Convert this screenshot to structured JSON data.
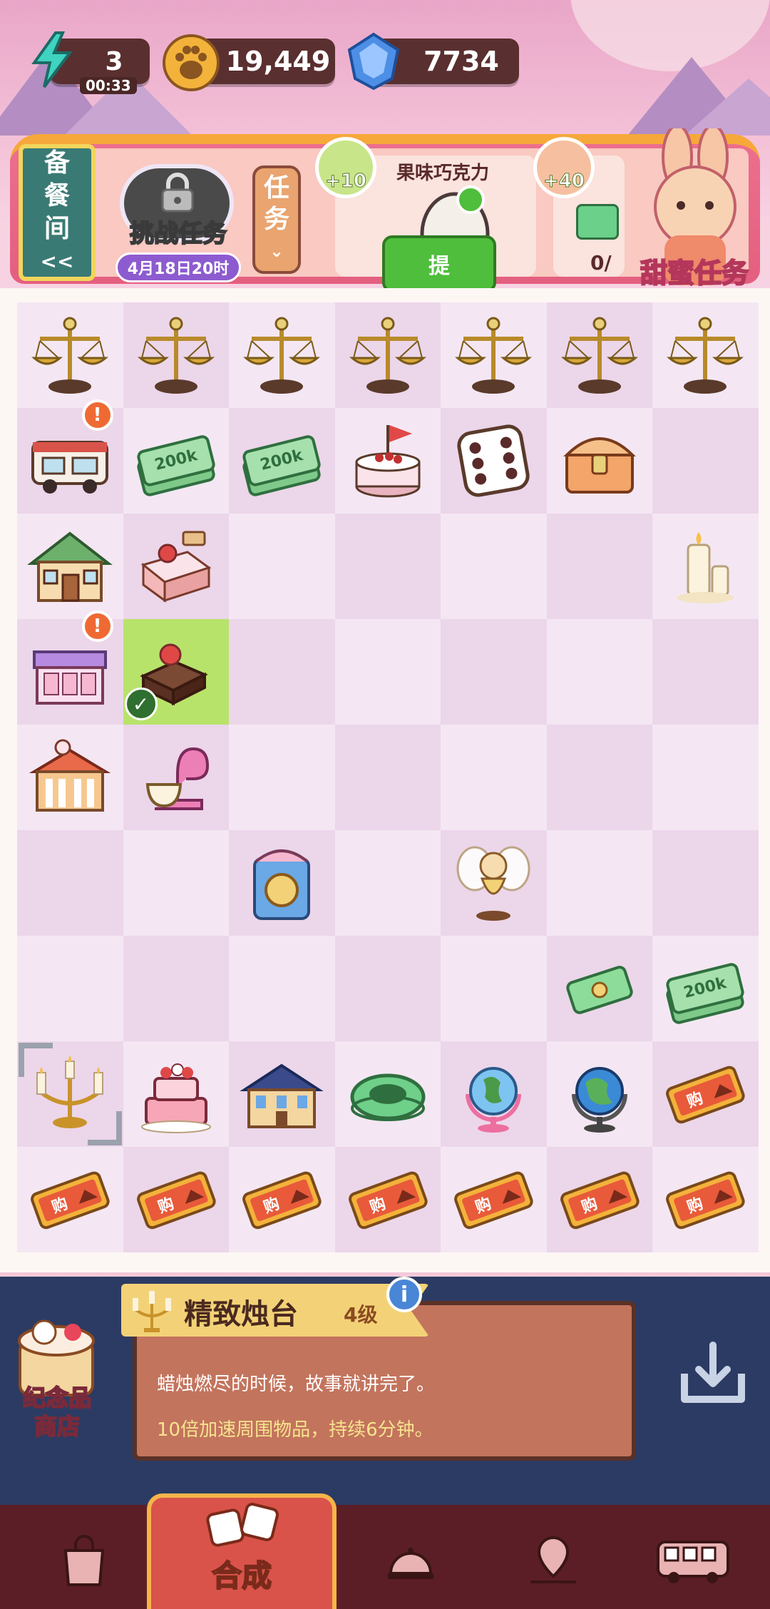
{
  "topbar": {
    "energy_value": "3",
    "energy_timer": "00:33",
    "coins_value": "19,449",
    "gems_value": "7734"
  },
  "banner": {
    "storage_label_line1": "备",
    "storage_label_line2": "餐",
    "storage_label_line3": "间",
    "storage_arrow": "<<",
    "challenge_label": "挑战任务",
    "challenge_date": "4月18日20时",
    "task_tab_line1": "任",
    "task_tab_line2": "务",
    "order1_reward": "+10",
    "order1_name": "果味巧克力",
    "order1_button": "提",
    "order2_reward": "+40",
    "order2_progress": "0/",
    "sweet_task_label": "甜蜜任务"
  },
  "board": {
    "rows": [
      [
        "scale",
        "scale",
        "scale",
        "scale",
        "scale",
        "scale",
        "scale"
      ],
      [
        "food-truck",
        "cash-200k",
        "cash-200k",
        "flag-cake",
        "dice",
        "chest",
        ""
      ],
      [
        "cottage",
        "strawberry-cake",
        "",
        "",
        "",
        "",
        "candle-melt"
      ],
      [
        "shop-stall",
        "chocolate",
        "",
        "",
        "",
        "",
        ""
      ],
      [
        "bakery",
        "mixer",
        "",
        "",
        "",
        "",
        ""
      ],
      [
        "",
        "",
        "trophy-frame",
        "",
        "fairy",
        "",
        ""
      ],
      [
        "",
        "",
        "",
        "",
        "",
        "ticket",
        "cash-200k"
      ],
      [
        "candelabra",
        "tiered-cake",
        "mansion",
        "film-ring",
        "globe-pink",
        "globe-blue",
        "coupon"
      ],
      [
        "coupon",
        "coupon",
        "coupon",
        "coupon",
        "coupon",
        "coupon",
        "coupon"
      ]
    ],
    "cash_label": "200k",
    "coupon_label": "购"
  },
  "info": {
    "item_name": "精致烛台",
    "item_level": "4级",
    "item_description": "蜡烛燃尽的时候，故事就讲完了。",
    "item_effect": "10倍加速周围物品，持续6分钟。",
    "info_button": "i",
    "shop_line1": "纪念品",
    "shop_line2": "商店"
  },
  "nav": {
    "active_label": "合成"
  },
  "colors": {
    "banner": "#e45f7f",
    "selected_cell": "#b7e36b",
    "nav_bg": "#5c1e26",
    "nav_active": "#d9534a"
  }
}
